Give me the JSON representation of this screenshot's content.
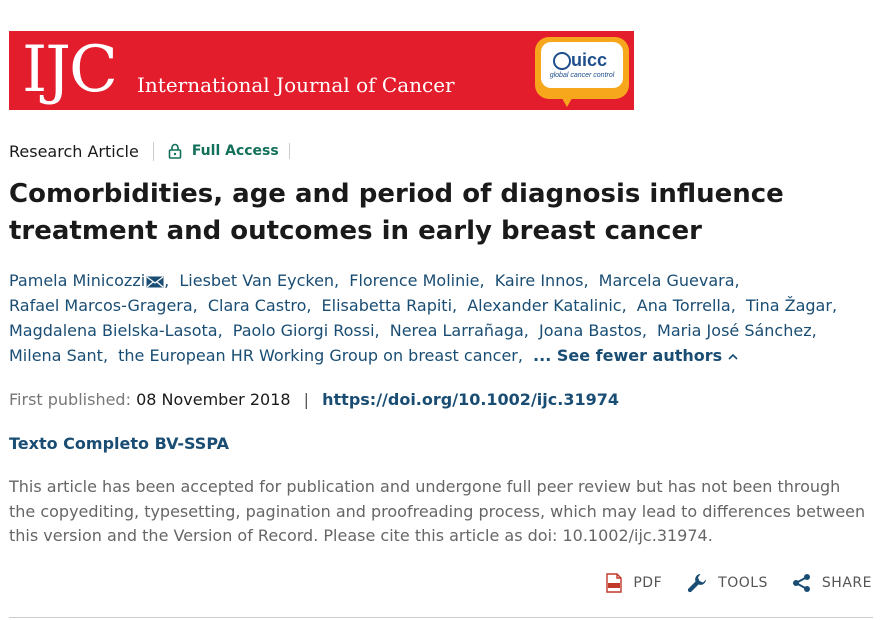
{
  "banner": {
    "logo": "IJC",
    "journal_title": "International Journal of Cancer",
    "partner_logo": "uicc",
    "partner_tagline": "global cancer control"
  },
  "meta": {
    "article_type": "Research Article",
    "access": "Full Access"
  },
  "title": "Comorbidities, age and period of diagnosis influence treatment and outcomes in early breast cancer",
  "authors": [
    "Pamela Minicozzi",
    "Liesbet Van Eycken",
    "Florence Molinie",
    "Kaire Innos",
    "Marcela Guevara",
    "Rafael Marcos-Gragera",
    "Clara Castro",
    "Elisabetta Rapiti",
    "Alexander Katalinic",
    "Ana Torrella",
    "Tina Žagar",
    "Magdalena Bielska-Lasota",
    "Paolo Giorgi Rossi",
    "Nerea Larrañaga",
    "Joana Bastos",
    "Maria José Sánchez",
    "Milena Sant",
    "the European HR Working Group on breast cancer"
  ],
  "see_fewer": "... See fewer authors",
  "published": {
    "label": "First published:",
    "date": "08 November 2018",
    "separator": "|",
    "doi": "https://doi.org/10.1002/ijc.31974"
  },
  "texto_link": "Texto Completo BV-SSPA",
  "notice": "This article has been accepted for publication and undergone full peer review but has not been through the copyediting, typesetting, pagination and proofreading process, which may lead to differences between this version and the Version of Record. Please cite this article as doi: 10.1002/ijc.31974.",
  "actions": {
    "pdf": "PDF",
    "tools": "TOOLS",
    "share": "SHARE"
  },
  "colors": {
    "banner_red": "#e41d2d",
    "link_blue": "#1a4d73",
    "access_green": "#12705a",
    "uicc_orange": "#f7a71c"
  },
  "icons": [
    "lock-icon",
    "mail-icon",
    "chevron-up-icon",
    "pdf-icon",
    "wrench-icon",
    "share-icon"
  ]
}
